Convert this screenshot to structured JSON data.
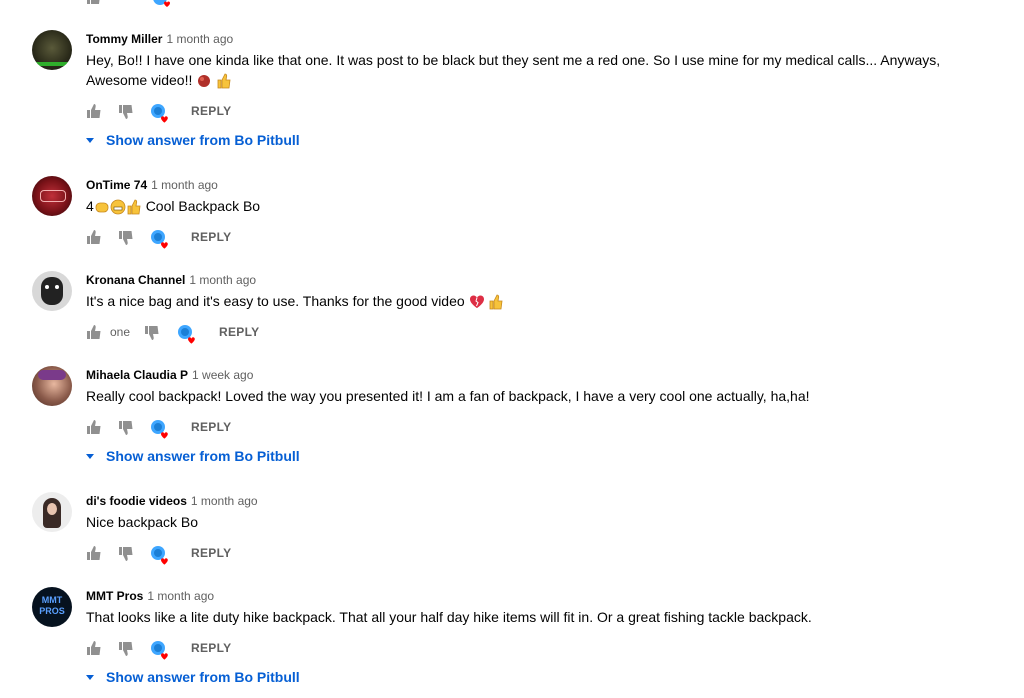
{
  "comments": [
    {
      "author": "Tommy Miller",
      "time": "1 month ago",
      "text": "Hey, Bo!! I have one kinda like that one. It was post to be black but they sent me a red one. So I use mine for my medical calls... Anyways, Awesome video!!",
      "likes": "",
      "reply": "REPLY",
      "answers": "Show answer from Bo Pitbull"
    },
    {
      "author": "OnTime 74",
      "time": "1 month ago",
      "text_prefix": "4",
      "text": "Cool Backpack Bo",
      "likes": "",
      "reply": "REPLY"
    },
    {
      "author": "Kronana Channel",
      "time": "1 month ago",
      "text": "It's a nice bag and it's easy to use. Thanks for the good video",
      "likes": "one",
      "reply": "REPLY"
    },
    {
      "author": "Mihaela Claudia P",
      "time": "1 week ago",
      "text": "Really cool backpack! Loved the way you presented it! I am a fan of backpack, I have a very cool one actually, ha,ha!",
      "likes": "",
      "reply": "REPLY",
      "answers": "Show answer from Bo Pitbull"
    },
    {
      "author": "di's foodie videos",
      "time": "1 month ago",
      "text": "Nice backpack Bo",
      "likes": "",
      "reply": "REPLY"
    },
    {
      "author": "MMT Pros",
      "time": "1 month ago",
      "avatar_text": "MMT PROS",
      "text": "That looks like a lite duty hike backpack. That all your half day hike items will fit in. Or a great fishing tackle backpack.",
      "likes": "",
      "reply": "REPLY",
      "answers": "Show answer from Bo Pitbull"
    }
  ],
  "colors": {
    "link": "#065fd4",
    "muted": "#606060",
    "heart": "#ff0000"
  }
}
